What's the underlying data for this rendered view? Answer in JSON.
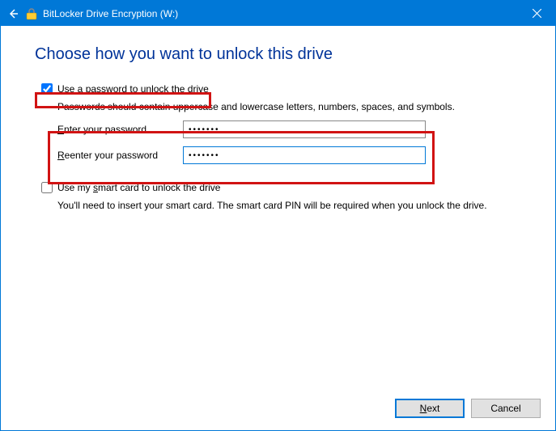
{
  "titlebar": {
    "title": "BitLocker Drive Encryption (W:)"
  },
  "heading": "Choose how you want to unlock this drive",
  "opt_password": {
    "checkbox_label_pre": "Use a ",
    "checkbox_label_accel": "p",
    "checkbox_label_post": "assword to unlock the drive",
    "checked": true,
    "helper": "Passwords should contain uppercase and lowercase letters, numbers, spaces, and symbols.",
    "enter_label_accel": "E",
    "enter_label_rest": "nter your password",
    "enter_value": "•••••••",
    "reenter_label_pre": "",
    "reenter_label_accel": "R",
    "reenter_label_rest": "eenter your password",
    "reenter_value": "•••••••"
  },
  "opt_smartcard": {
    "checkbox_label_pre": "Use my ",
    "checkbox_label_accel": "s",
    "checkbox_label_post": "mart card to unlock the drive",
    "checked": false,
    "helper": "You'll need to insert your smart card. The smart card PIN will be required when you unlock the drive."
  },
  "buttons": {
    "next_accel": "N",
    "next_rest": "ext",
    "cancel": "Cancel"
  }
}
